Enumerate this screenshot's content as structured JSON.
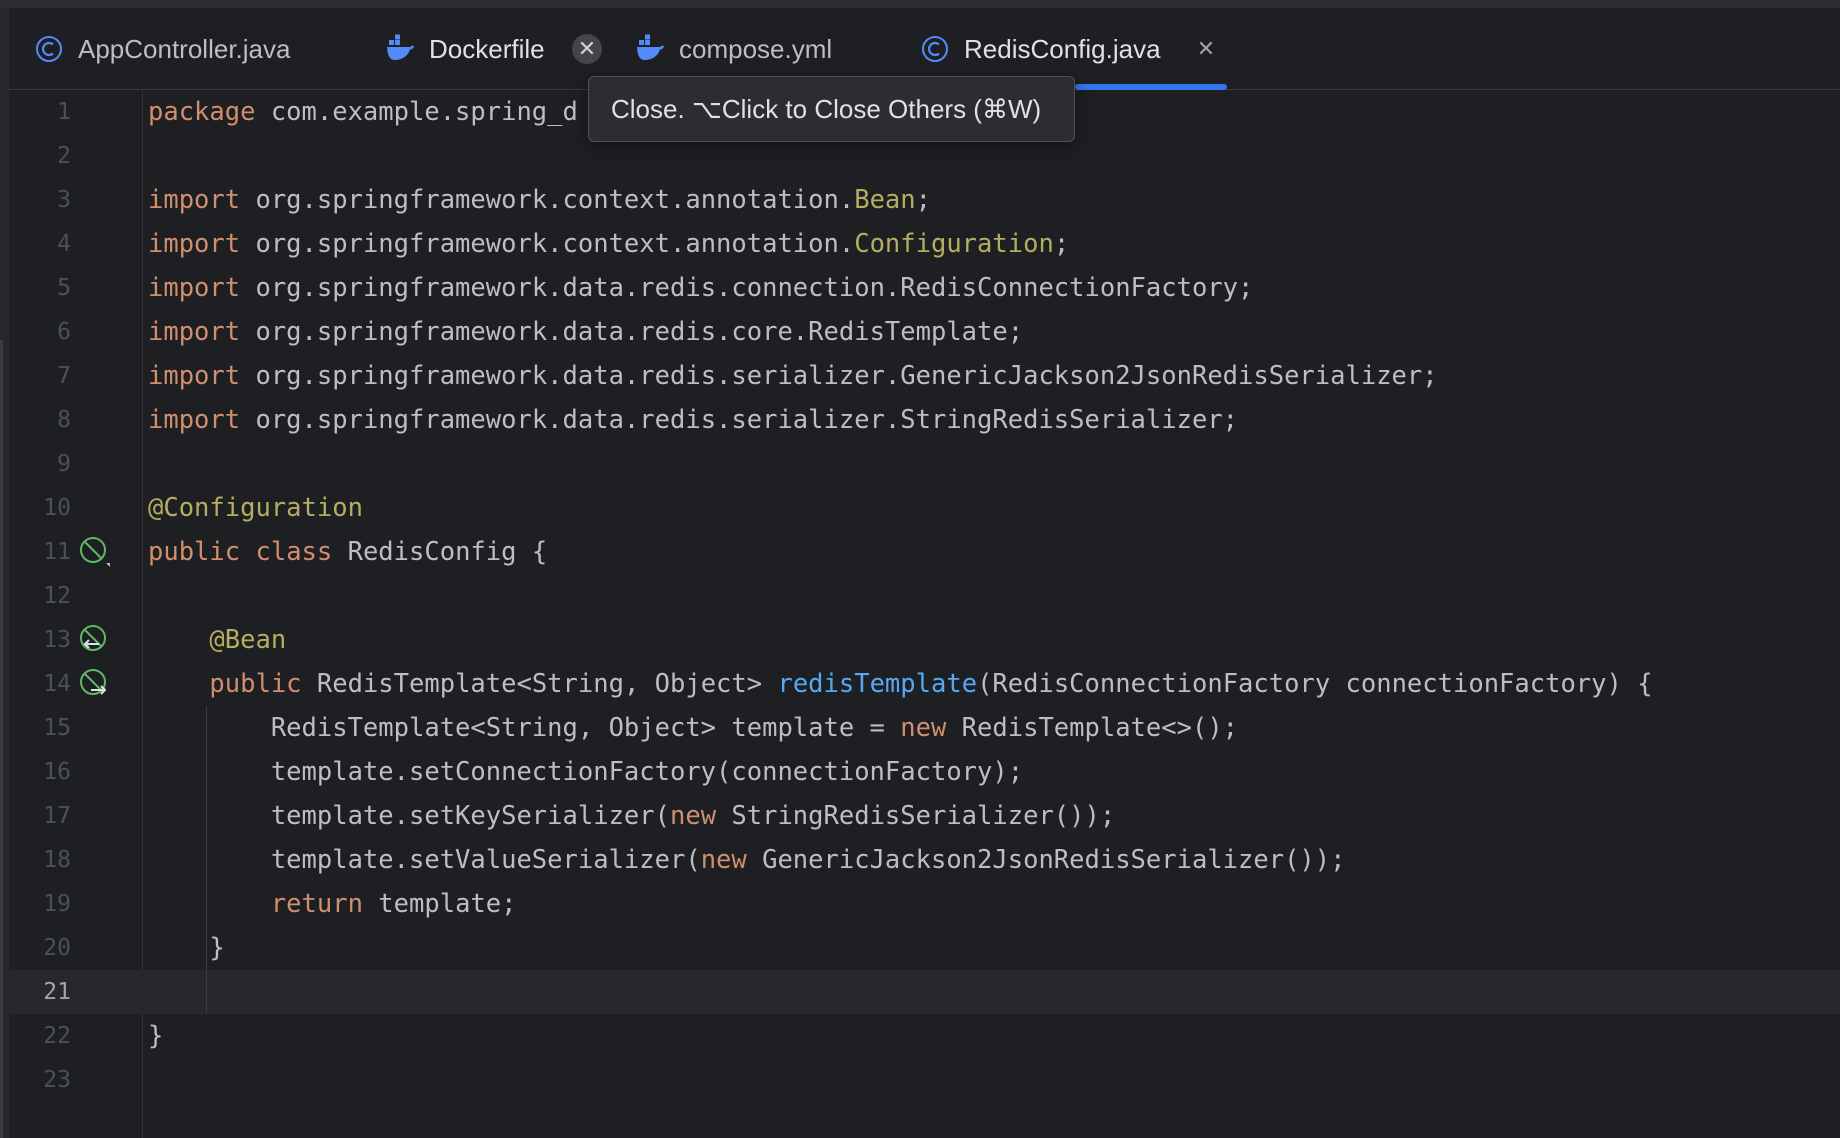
{
  "tabs": [
    {
      "label": "AppController.java",
      "icon": "java-class-icon"
    },
    {
      "label": "Dockerfile",
      "icon": "docker-icon",
      "close": "✕"
    },
    {
      "label": "compose.yml",
      "icon": "docker-icon"
    },
    {
      "label": "RedisConfig.java",
      "icon": "java-class-icon",
      "close": "✕",
      "active": true
    }
  ],
  "tooltip": "Close. ⌥Click to Close Others (⌘W)",
  "colors": {
    "keyword": "#cf8e6d",
    "annotation": "#b3ae60",
    "method": "#56a8f5",
    "text": "#bcbec4",
    "accent": "#3574f0",
    "gutter_icon": "#5fb865"
  },
  "editor": {
    "current_line": 21,
    "lines": [
      {
        "n": "1",
        "tokens": [
          {
            "t": "package",
            "c": "kw"
          },
          {
            "t": " com.example.spring_d"
          }
        ]
      },
      {
        "n": "2",
        "tokens": []
      },
      {
        "n": "3",
        "tokens": [
          {
            "t": "import",
            "c": "kw"
          },
          {
            "t": " org.springframework.context.annotation."
          },
          {
            "t": "Bean",
            "c": "ann"
          },
          {
            "t": ";"
          }
        ]
      },
      {
        "n": "4",
        "tokens": [
          {
            "t": "import",
            "c": "kw"
          },
          {
            "t": " org.springframework.context.annotation."
          },
          {
            "t": "Configuration",
            "c": "ann"
          },
          {
            "t": ";"
          }
        ]
      },
      {
        "n": "5",
        "tokens": [
          {
            "t": "import",
            "c": "kw"
          },
          {
            "t": " org.springframework.data.redis.connection.RedisConnectionFactory;"
          }
        ]
      },
      {
        "n": "6",
        "tokens": [
          {
            "t": "import",
            "c": "kw"
          },
          {
            "t": " org.springframework.data.redis.core.RedisTemplate;"
          }
        ]
      },
      {
        "n": "7",
        "tokens": [
          {
            "t": "import",
            "c": "kw"
          },
          {
            "t": " org.springframework.data.redis.serializer.GenericJackson2JsonRedisSerializer;"
          }
        ]
      },
      {
        "n": "8",
        "tokens": [
          {
            "t": "import",
            "c": "kw"
          },
          {
            "t": " org.springframework.data.redis.serializer.StringRedisSerializer;"
          }
        ]
      },
      {
        "n": "9",
        "tokens": []
      },
      {
        "n": "10",
        "tokens": [
          {
            "t": "@Configuration",
            "c": "ann"
          }
        ]
      },
      {
        "n": "11",
        "gutter": "spring-bean-icon",
        "tokens": [
          {
            "t": "public",
            "c": "kw"
          },
          {
            "t": " "
          },
          {
            "t": "class",
            "c": "kw"
          },
          {
            "t": " RedisConfig {"
          }
        ]
      },
      {
        "n": "12",
        "tokens": []
      },
      {
        "n": "13",
        "gutter": "spring-bean-left-icon",
        "tokens": [
          {
            "t": "    "
          },
          {
            "t": "@Bean",
            "c": "ann"
          }
        ]
      },
      {
        "n": "14",
        "gutter": "spring-bean-right-icon",
        "tokens": [
          {
            "t": "    "
          },
          {
            "t": "public",
            "c": "kw"
          },
          {
            "t": " RedisTemplate<String, Object> "
          },
          {
            "t": "redisTemplate",
            "c": "fn"
          },
          {
            "t": "(RedisConnectionFactory connectionFactory) {"
          }
        ]
      },
      {
        "n": "15",
        "tokens": [
          {
            "t": "        RedisTemplate<String, Object> template = "
          },
          {
            "t": "new",
            "c": "kw"
          },
          {
            "t": " RedisTemplate<>();"
          }
        ]
      },
      {
        "n": "16",
        "tokens": [
          {
            "t": "        template.setConnectionFactory(connectionFactory);"
          }
        ]
      },
      {
        "n": "17",
        "tokens": [
          {
            "t": "        template.setKeySerializer("
          },
          {
            "t": "new",
            "c": "kw"
          },
          {
            "t": " StringRedisSerializer());"
          }
        ]
      },
      {
        "n": "18",
        "tokens": [
          {
            "t": "        template.setValueSerializer("
          },
          {
            "t": "new",
            "c": "kw"
          },
          {
            "t": " GenericJackson2JsonRedisSerializer());"
          }
        ]
      },
      {
        "n": "19",
        "tokens": [
          {
            "t": "        "
          },
          {
            "t": "return",
            "c": "kw"
          },
          {
            "t": " template;"
          }
        ]
      },
      {
        "n": "20",
        "tokens": [
          {
            "t": "    }"
          }
        ]
      },
      {
        "n": "21",
        "tokens": []
      },
      {
        "n": "22",
        "tokens": [
          {
            "t": "}"
          }
        ]
      },
      {
        "n": "23",
        "tokens": []
      }
    ]
  }
}
